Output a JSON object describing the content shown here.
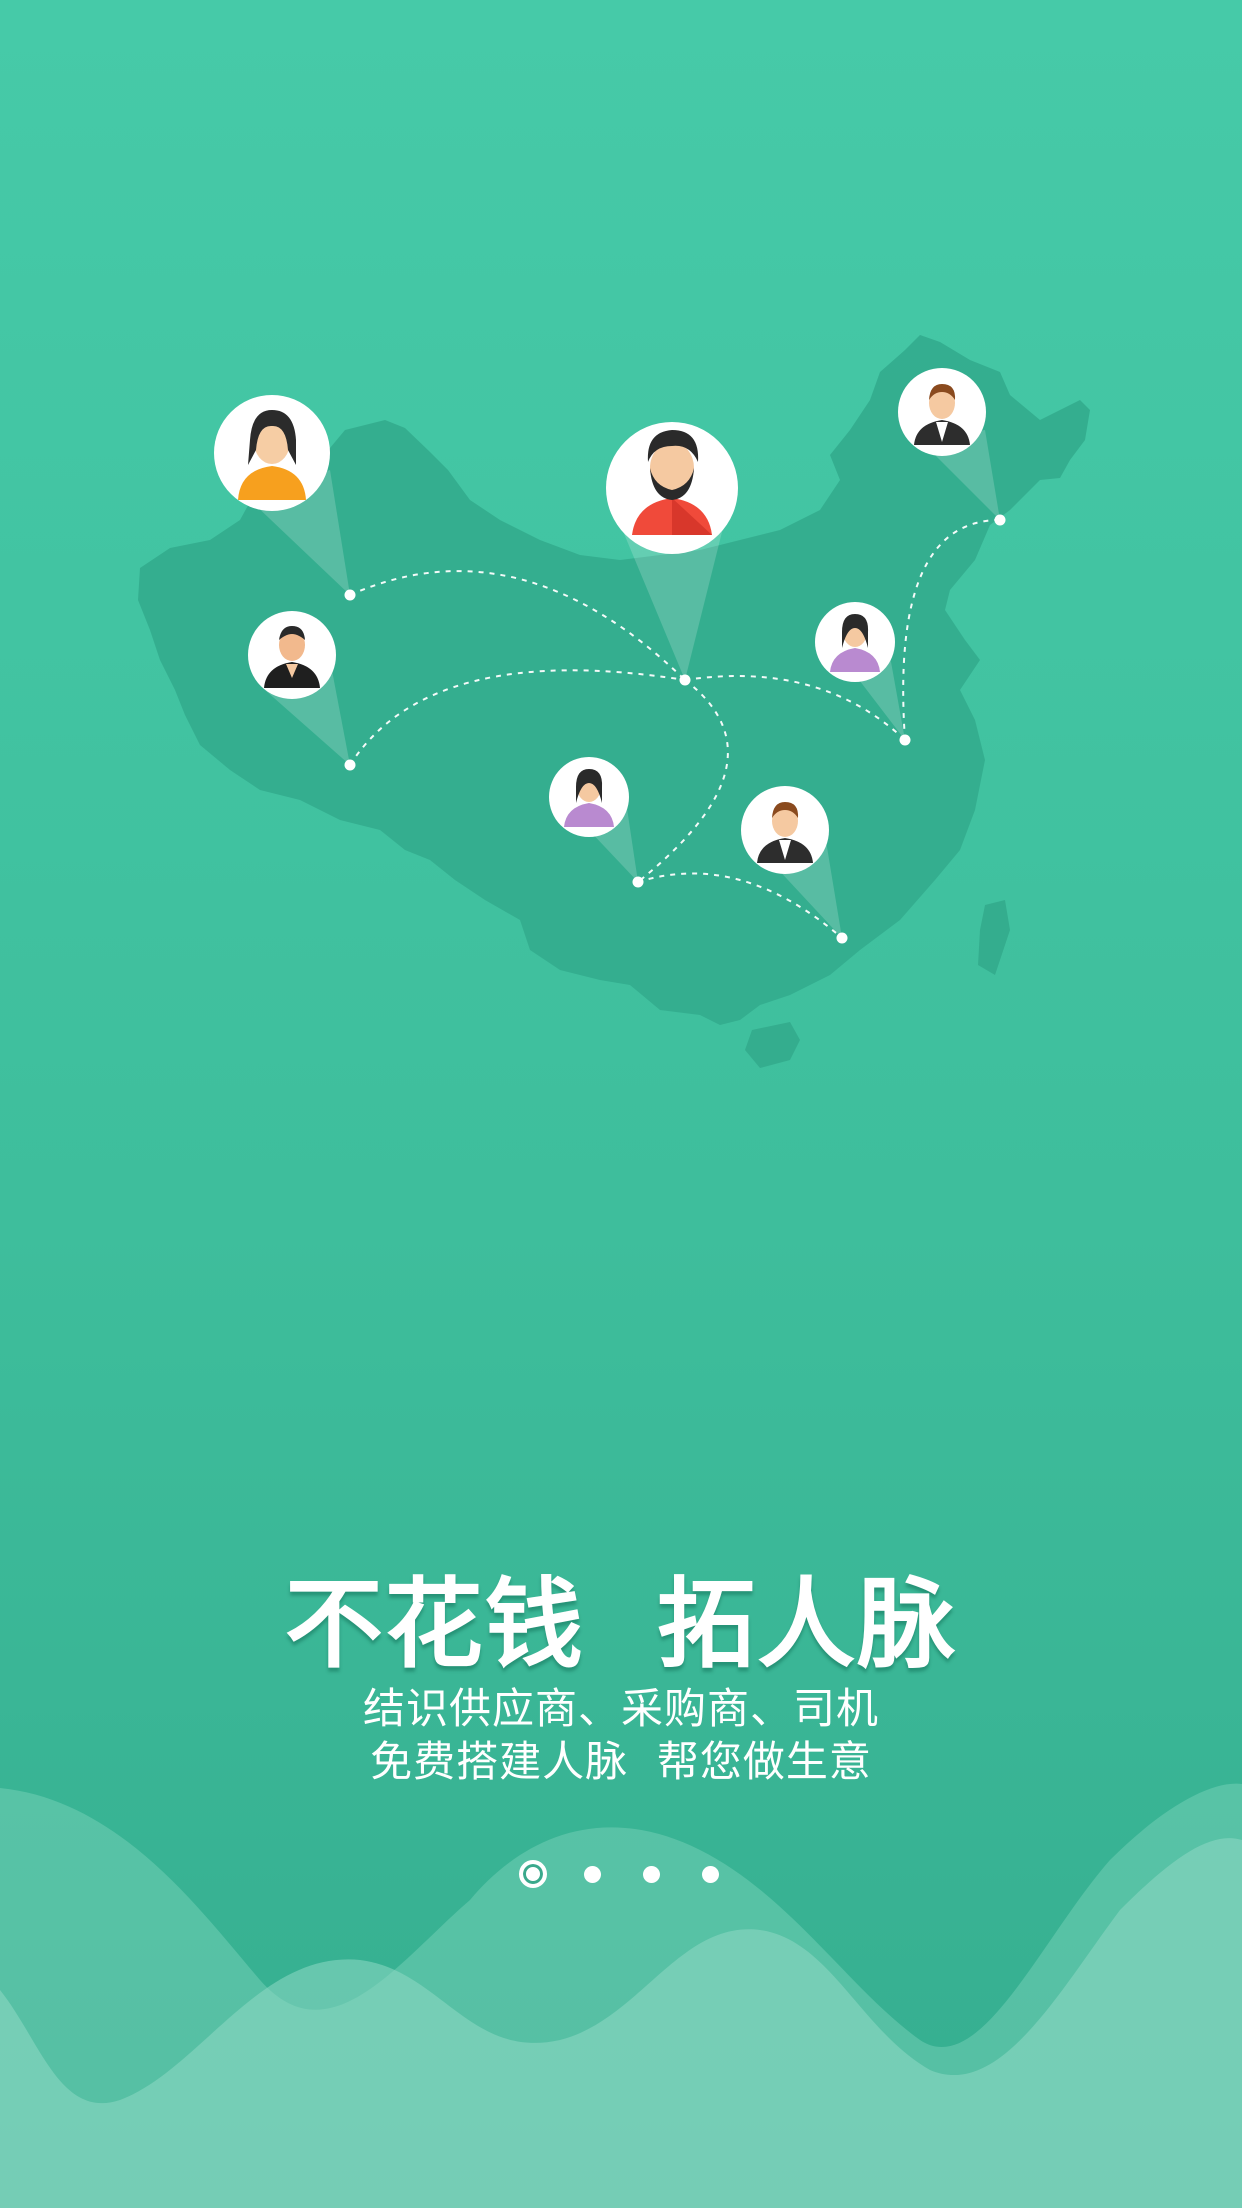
{
  "headline": "不花钱  拓人脉",
  "subtitle_line1": "结识供应商、采购商、司机",
  "subtitle_line2": "免费搭建人脉  帮您做生意",
  "pager": {
    "page_count": 4,
    "active_page": 1
  },
  "avatars": [
    {
      "name": "avatar-woman-orange",
      "icon": "woman-orange-shirt-icon"
    },
    {
      "name": "avatar-man-beard-red",
      "icon": "bearded-man-red-shirt-icon"
    },
    {
      "name": "avatar-man-suit-northeast",
      "icon": "businessman-suit-icon"
    },
    {
      "name": "avatar-man-black-west",
      "icon": "man-black-shirt-icon"
    },
    {
      "name": "avatar-woman-purple-east",
      "icon": "woman-purple-shirt-icon"
    },
    {
      "name": "avatar-woman-purple-south",
      "icon": "woman-purple-shirt-icon"
    },
    {
      "name": "avatar-man-suit-south",
      "icon": "businessman-suit-icon"
    }
  ],
  "colors": {
    "background_top": "#46caa8",
    "background_bottom": "#35ad8f",
    "map_fill": "#34ad8e",
    "wave_light": "#7fd4bd",
    "text": "#ffffff"
  }
}
